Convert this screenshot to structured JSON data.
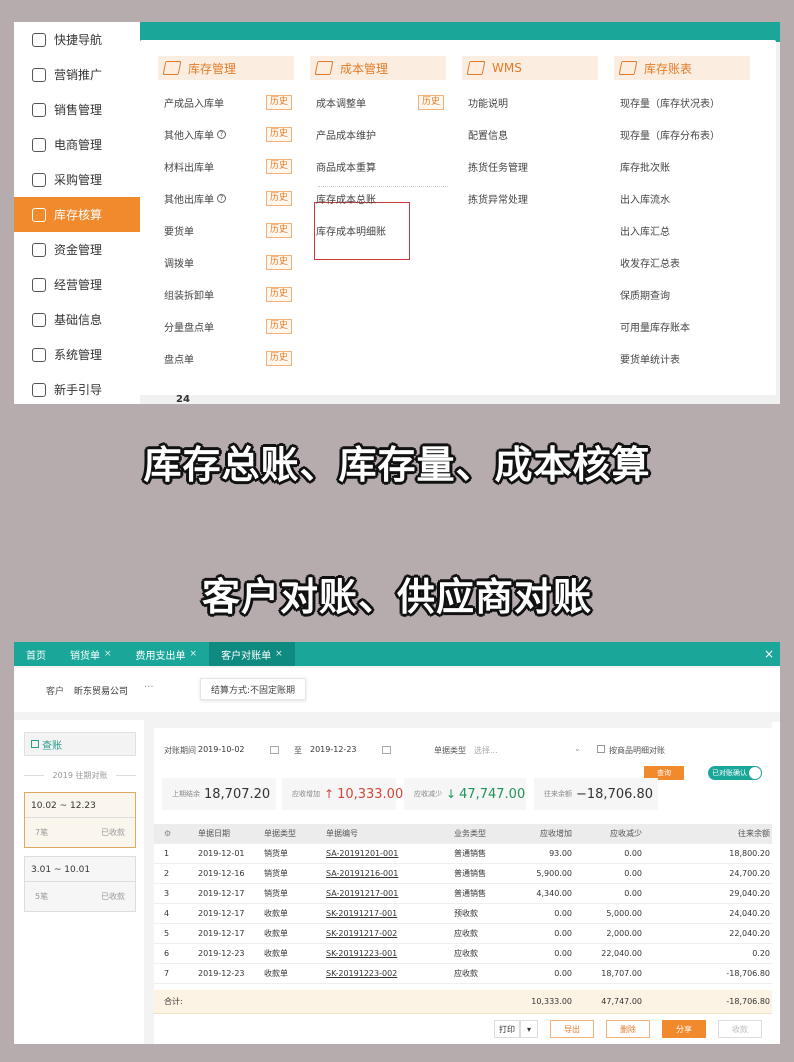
{
  "panel1": {
    "sidebar": [
      {
        "label": "快捷导航",
        "icon": "home-icon"
      },
      {
        "label": "营销推广",
        "icon": "gift-icon"
      },
      {
        "label": "销售管理",
        "icon": "sales-icon"
      },
      {
        "label": "电商管理",
        "icon": "shop-icon"
      },
      {
        "label": "采购管理",
        "icon": "bag-icon"
      },
      {
        "label": "库存核算",
        "icon": "warehouse-icon",
        "active": true
      },
      {
        "label": "资金管理",
        "icon": "money-icon"
      },
      {
        "label": "经营管理",
        "icon": "report-icon"
      },
      {
        "label": "基础信息",
        "icon": "info-icon"
      },
      {
        "label": "系统管理",
        "icon": "settings-icon"
      },
      {
        "label": "新手引导",
        "icon": "guide-icon"
      }
    ],
    "columns": [
      {
        "title": "库存管理",
        "icon": "inventory-icon",
        "items": [
          {
            "label": "产成品入库单",
            "badge": "历史"
          },
          {
            "label": "其他入库单",
            "help": "?",
            "badge": "历史"
          },
          {
            "label": "材料出库单",
            "badge": "历史"
          },
          {
            "label": "其他出库单",
            "help": "?",
            "badge": "历史"
          },
          {
            "label": "要货单",
            "badge": "历史"
          },
          {
            "label": "调拨单",
            "badge": "历史"
          },
          {
            "label": "组装拆卸单",
            "badge": "历史"
          },
          {
            "label": "分量盘点单",
            "badge": "历史"
          },
          {
            "label": "盘点单",
            "badge": "历史"
          }
        ]
      },
      {
        "title": "成本管理",
        "icon": "cost-icon",
        "items": [
          {
            "label": "成本调整单",
            "badge": "历史"
          },
          {
            "label": "产品成本维护"
          },
          {
            "label": "商品成本重算"
          },
          {
            "label": "库存成本总账"
          },
          {
            "label": "库存成本明细账"
          }
        ]
      },
      {
        "title": "WMS",
        "icon": "wms-icon",
        "items": [
          {
            "label": "功能说明"
          },
          {
            "label": "配置信息"
          },
          {
            "label": "拣货任务管理"
          },
          {
            "label": "拣货异常处理"
          }
        ]
      },
      {
        "title": "库存账表",
        "icon": "ledger-icon",
        "items": [
          {
            "label": "现存量（库存状况表）"
          },
          {
            "label": "现存量（库存分布表）"
          },
          {
            "label": "库存批次账"
          },
          {
            "label": "出入库流水"
          },
          {
            "label": "出入库汇总"
          },
          {
            "label": "收发存汇总表"
          },
          {
            "label": "保质期查询"
          },
          {
            "label": "可用量库存账本"
          },
          {
            "label": "要货单统计表"
          }
        ]
      }
    ],
    "bottom_number": "24"
  },
  "captions": {
    "line1": "库存总账、库存量、成本核算",
    "line2": "客户对账、供应商对账"
  },
  "panel2": {
    "tabs": [
      {
        "label": "首页",
        "close": false
      },
      {
        "label": "销货单",
        "close": true
      },
      {
        "label": "费用支出单",
        "close": true
      },
      {
        "label": "客户对账单",
        "close": true,
        "active": true
      }
    ],
    "close_icon": "×",
    "customer_label": "客户",
    "customer_value": "昕东贸易公司",
    "customer_more": "···",
    "settlement": "结算方式:不固定账期",
    "search_label": "查账",
    "year_label": "2019 往期对账",
    "periods": [
      {
        "range": "10.02 ~ 12.23",
        "count": "7笔",
        "status": "已收款",
        "selected": true
      },
      {
        "range": "3.01 ~ 10.01",
        "count": "5笔",
        "status": "已收款",
        "selected": false
      }
    ],
    "filters": {
      "period_label": "对账期间",
      "start": "2019-10-02",
      "to": "至",
      "end": "2019-12-23",
      "doc_type_label": "单据类型",
      "doc_type_placeholder": "选择...",
      "detail_label": "按商品明细对账",
      "query_label": "查询",
      "toggle_label": "已对账确认"
    },
    "summary": {
      "opening_label": "上期结余",
      "opening": "18,707.20",
      "increase_label": "应收增加",
      "increase": "10,333.00",
      "decrease_label": "应收减少",
      "decrease": "47,747.00",
      "balance_label": "往来余额",
      "balance": "−18,706.80"
    },
    "table": {
      "headers": [
        "",
        "单据日期",
        "单据类型",
        "单据编号",
        "业务类型",
        "应收增加",
        "应收减少",
        "往来余额"
      ],
      "rows": [
        [
          "1",
          "2019-12-01",
          "销货单",
          "SA-20191201-001",
          "普通销售",
          "93.00",
          "0.00",
          "18,800.20"
        ],
        [
          "2",
          "2019-12-16",
          "销货单",
          "SA-20191216-001",
          "普通销售",
          "5,900.00",
          "0.00",
          "24,700.20"
        ],
        [
          "3",
          "2019-12-17",
          "销货单",
          "SA-20191217-001",
          "普通销售",
          "4,340.00",
          "0.00",
          "29,040.20"
        ],
        [
          "4",
          "2019-12-17",
          "收款单",
          "SK-20191217-001",
          "预收款",
          "0.00",
          "5,000.00",
          "24,040.20"
        ],
        [
          "5",
          "2019-12-17",
          "收款单",
          "SK-20191217-002",
          "应收款",
          "0.00",
          "2,000.00",
          "22,040.20"
        ],
        [
          "6",
          "2019-12-23",
          "收款单",
          "SK-20191223-001",
          "应收款",
          "0.00",
          "22,040.00",
          "0.20"
        ],
        [
          "7",
          "2019-12-23",
          "收款单",
          "SK-20191223-002",
          "应收款",
          "0.00",
          "18,707.00",
          "-18,706.80"
        ]
      ],
      "total": [
        "合计:",
        "10,333.00",
        "47,747.00",
        "-18,706.80"
      ]
    },
    "buttons": {
      "print": "打印",
      "print_more": "▾",
      "export": "导出",
      "delete": "删除",
      "share": "分享",
      "receive": "收款"
    }
  },
  "colors": {
    "teal": "#1aa79a",
    "orange": "#f08a2c",
    "highlight_red": "#c8383c"
  }
}
